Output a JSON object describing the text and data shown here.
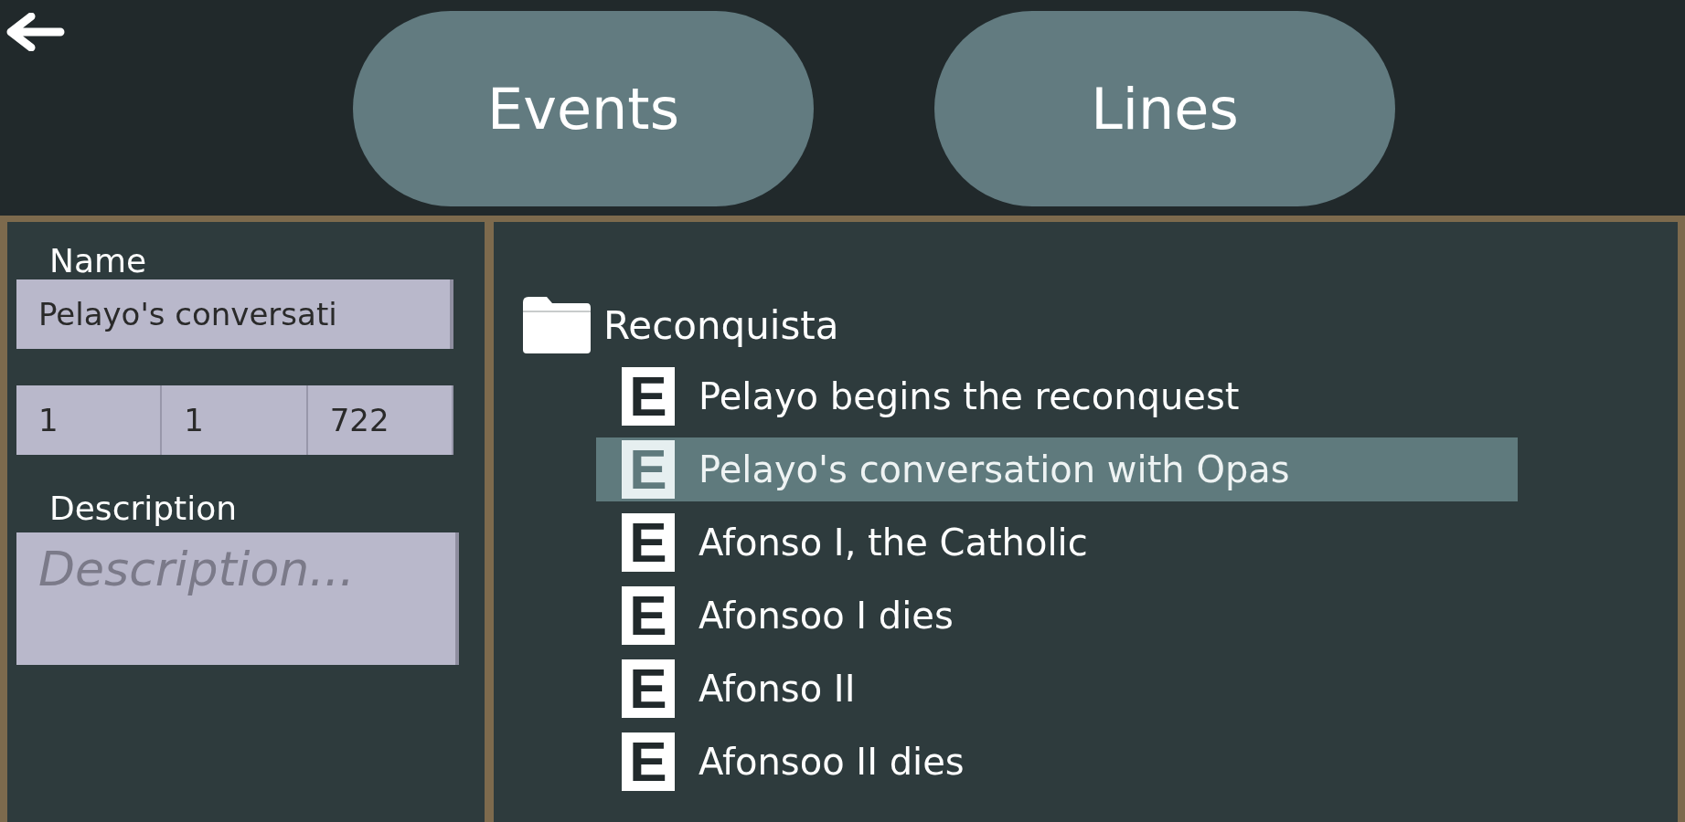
{
  "header": {
    "tabs": [
      {
        "label": "Events"
      },
      {
        "label": "Lines"
      }
    ]
  },
  "editor": {
    "name_label": "Name",
    "name_value": "Pelayo's conversati",
    "date": [
      "1",
      "1",
      "722"
    ],
    "description_label": "Description",
    "description_placeholder": "Description..."
  },
  "tree": {
    "folder": "Reconquista",
    "children": [
      {
        "badge": "E",
        "label": "Pelayo begins the reconquest",
        "selected": false
      },
      {
        "badge": "E",
        "label": "Pelayo's conversation with Opas",
        "selected": true
      },
      {
        "badge": "E",
        "label": "Afonso I, the Catholic",
        "selected": false
      },
      {
        "badge": "E",
        "label": "Afonsoo I dies",
        "selected": false
      },
      {
        "badge": "E",
        "label": "Afonso II",
        "selected": false
      },
      {
        "badge": "E",
        "label": "Afonsoo II dies",
        "selected": false
      }
    ]
  }
}
